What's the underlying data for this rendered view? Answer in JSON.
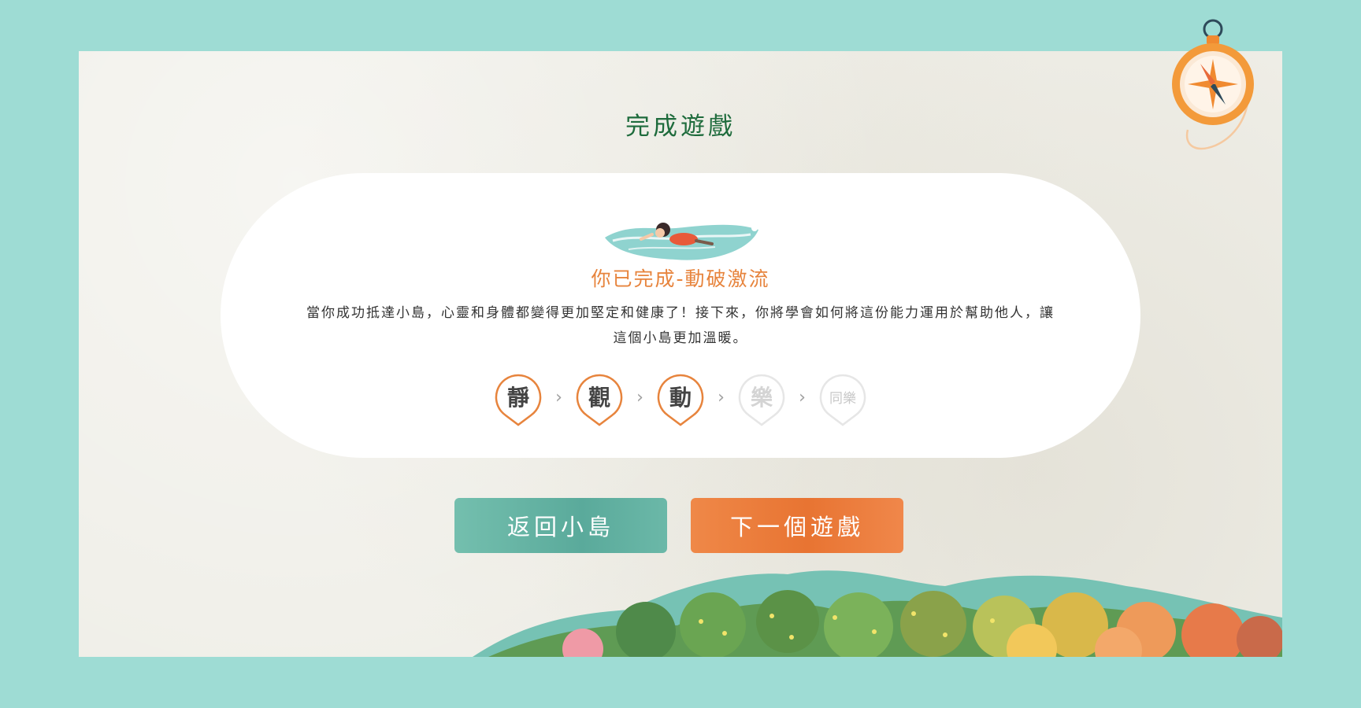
{
  "page": {
    "title": "完成遊戲"
  },
  "result_card": {
    "stage_title": "你已完成-動破激流",
    "description": "當你成功抵達小島，心靈和身體都變得更加堅定和健康了！接下來，你將學會如何將這份能力運用於幫助他人，讓這個小島更加溫暖。",
    "illustration": "swimmer-in-water",
    "steps": [
      {
        "label": "靜",
        "status": "completed"
      },
      {
        "label": "觀",
        "status": "completed"
      },
      {
        "label": "動",
        "status": "completed"
      },
      {
        "label": "樂",
        "status": "locked"
      },
      {
        "label": "同樂",
        "status": "locked"
      }
    ],
    "step_separator": "›"
  },
  "buttons": {
    "back_label": "返回小島",
    "next_label": "下一個遊戲"
  },
  "colors": {
    "background": "#9edcd4",
    "paper": "#efeee7",
    "title_green": "#1e6b3c",
    "accent_orange": "#e7843d",
    "teal_button": "#5aaa9b",
    "orange_button": "#e87432"
  },
  "icons": {
    "compass": "compass-icon",
    "step_pin": "location-pin-icon",
    "separator": "chevron-right-icon"
  }
}
